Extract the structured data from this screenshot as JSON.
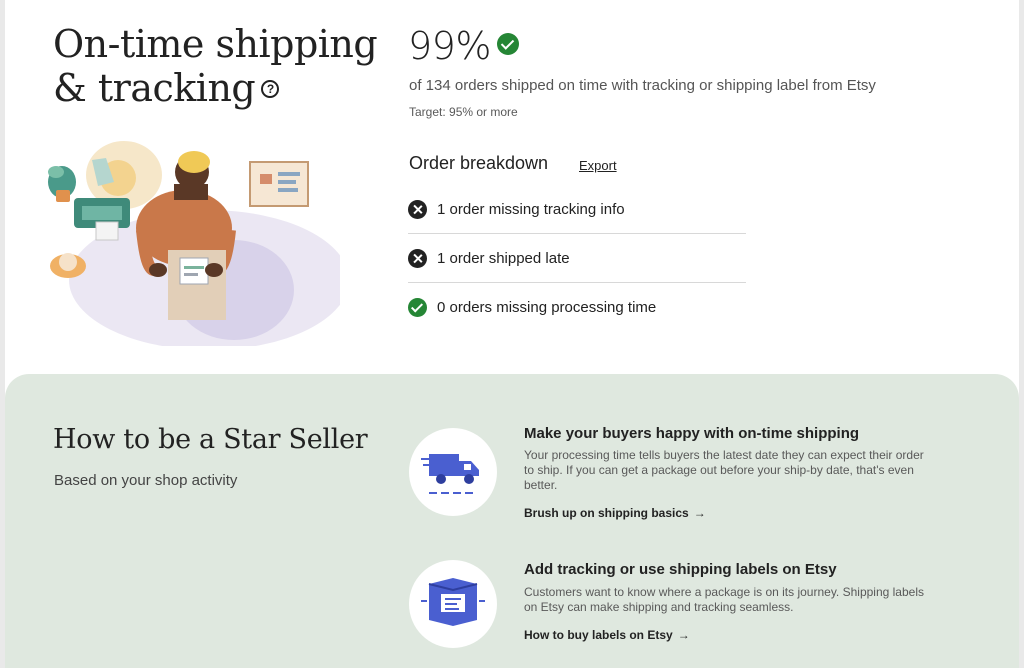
{
  "header": {
    "title_line1": "On-time shipping",
    "title_line2": "& tracking",
    "help_icon": "?"
  },
  "metric": {
    "percent": "99%",
    "summary": "of 134 orders shipped on time with tracking or shipping label from Etsy",
    "target": "Target: 95% or more"
  },
  "breakdown": {
    "title": "Order breakdown",
    "export_label": "Export",
    "items": [
      {
        "label": "1 order missing tracking info",
        "status": "fail",
        "icon": "x-circle-icon"
      },
      {
        "label": "1 order shipped late",
        "status": "fail",
        "icon": "x-circle-icon"
      },
      {
        "label": "0 orders missing processing time",
        "status": "pass",
        "icon": "check-circle-icon"
      }
    ]
  },
  "star_seller": {
    "title": "How to be a Star Seller",
    "subtitle": "Based on your shop activity",
    "tips": [
      {
        "icon": "delivery-truck-icon",
        "title": "Make your buyers happy with on-time shipping",
        "description": "Your processing time tells buyers the latest date they can expect their order to ship. If you can get a package out before your ship-by date, that's even better.",
        "link": "Brush up on shipping basics"
      },
      {
        "icon": "package-label-icon",
        "title": "Add tracking or use shipping labels on Etsy",
        "description": "Customers want to know where a package is on its journey. Shipping labels on Etsy can make shipping and tracking seamless.",
        "link": "How to buy labels on Etsy"
      }
    ]
  },
  "colors": {
    "success_green": "#258635",
    "panel_background": "#dfe8df",
    "accent_blue": "#4a5fd0"
  }
}
